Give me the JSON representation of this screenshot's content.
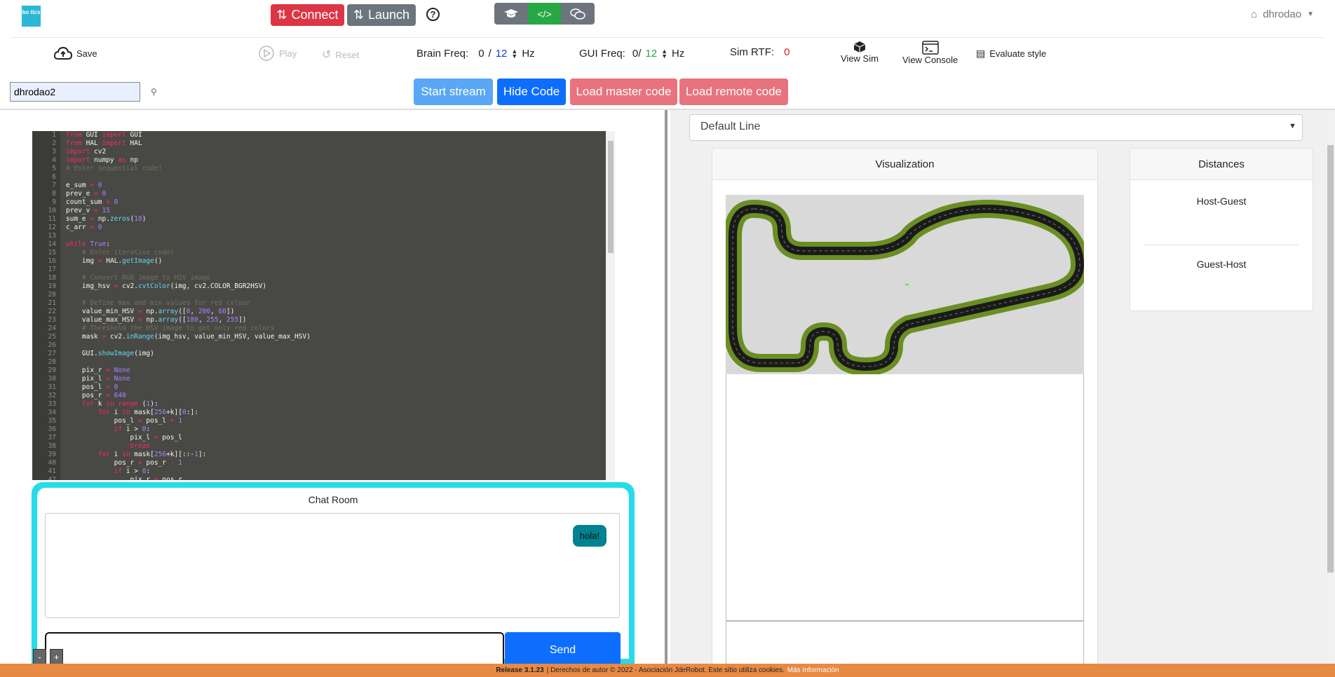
{
  "header": {
    "logo_text": "bo tics",
    "connect_label": "Connect",
    "launch_label": "Launch",
    "help_icon": "question-circle-icon",
    "mode_buttons": [
      "exercise-mode-icon",
      "code-mode-icon",
      "chat-mode-icon"
    ],
    "user_name": "dhrodao",
    "colors": {
      "connect": "#dc3545",
      "launch": "#6c757d",
      "mode": "#6c757d",
      "mode_active": "#28a745"
    }
  },
  "toolbar": {
    "save_label": "Save",
    "play_label": "Play",
    "reset_label": "Reset",
    "brain_freq_label": "Brain Freq:",
    "brain_freq_value": "0",
    "brain_freq_sep": "/",
    "brain_freq_target": "12",
    "brain_freq_unit": "Hz",
    "gui_freq_label": "GUI Freq:",
    "gui_freq_value": "0/",
    "gui_freq_target": "12",
    "gui_freq_unit": "Hz",
    "sim_rtf_label": "Sim RTF:",
    "sim_rtf_value": "0",
    "view_sim_label": "View Sim",
    "view_console_label": "View Console",
    "evaluate_label": "Evaluate style"
  },
  "session": {
    "room_value": "dhrodao2"
  },
  "actions": {
    "start_stream": "Start stream",
    "hide_code": "Hide Code",
    "load_master": "Load master code",
    "load_remote": "Load remote code"
  },
  "editor": {
    "lines": [
      "from GUI import GUI",
      "from HAL import HAL",
      "import cv2",
      "import numpy as np",
      "# Enter sequential code!",
      "",
      "e_sum = 0",
      "prev_e = 0",
      "count_sum = 0",
      "prev_v = 15",
      "sum_e = np.zeros(10)",
      "c_arr = 0",
      "",
      "while True:",
      "    # Enter iterative code!",
      "    img = HAL.getImage()",
      "",
      "    # Convert RGB image to HSV image",
      "    img_hsv = cv2.cvtColor(img, cv2.COLOR_BGR2HSV)",
      "",
      "    # Define max and min values for red colour",
      "    value_min_HSV = np.array([0, 200, 60])",
      "    value_max_HSV = np.array([180, 255, 255])",
      "    # Threshold the HSV image to get only red colors",
      "    mask = cv2.inRange(img_hsv, value_min_HSV, value_max_HSV)",
      "",
      "    GUI.showImage(img)",
      "",
      "    pix_r = None",
      "    pix_l = None",
      "    pos_l = 0",
      "    pos_r = 640",
      "    for k in range (1):",
      "        for i in mask[256+k][0:]:",
      "            pos_l = pos_l + 1",
      "            if i > 0:",
      "                pix_l = pos_l",
      "                break",
      "        for i in mask[256+k][::-1]:",
      "            pos_r = pos_r - 1",
      "            if i > 0:",
      "                pix_r = pos_r"
    ]
  },
  "chat": {
    "title": "Chat Room",
    "messages": [
      "hola!"
    ],
    "input_value": "",
    "send_label": "Send",
    "zoom_minus": "-",
    "zoom_plus": "+"
  },
  "world": {
    "selected": "Default Line"
  },
  "visualization": {
    "title": "Visualization"
  },
  "distances": {
    "title": "Distances",
    "items": [
      "Host-Guest",
      "Guest-Host"
    ]
  },
  "footer": {
    "release": "Release 3.1.23",
    "text": "| Derechos de autor © 2022 - Asociación JdeRobot. Este sitio utiliza cookies.",
    "more": "Más Información",
    "color": "#e68a45"
  }
}
